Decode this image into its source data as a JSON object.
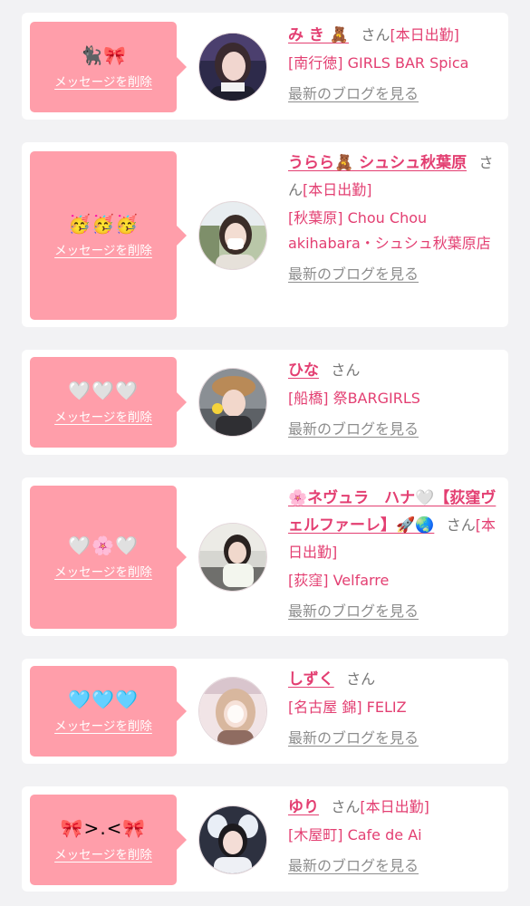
{
  "messages": [
    {
      "stamp": "🐈‍⬛🎀",
      "delete_label": "メッセージを削除",
      "name": "み き 🧸",
      "san": "さん",
      "status": "[本日出勤]",
      "shop": "[南行徳] GIRLS BAR Spica",
      "blog_label": "最新のブログを見る"
    },
    {
      "stamp": "🥳🥳🥳",
      "delete_label": "メッセージを削除",
      "name": "うらら🧸 シュシュ秋葉原",
      "san": "さん",
      "status": "[本日出勤]",
      "shop": "[秋葉原] Chou Chou akihabara・シュシュ秋葉原店",
      "blog_label": "最新のブログを見る"
    },
    {
      "stamp": "🤍🤍🤍",
      "delete_label": "メッセージを削除",
      "name": "ひな",
      "san": "さん",
      "status": "",
      "shop": "[船橋] 祭BARGIRLS",
      "blog_label": "最新のブログを見る"
    },
    {
      "stamp": "🤍🌸🤍",
      "delete_label": "メッセージを削除",
      "name": "🌸ネヴュラ　ハナ🤍【荻窪ヴェルファーレ】🚀🌏",
      "san": "さん",
      "status": "[本日出勤]",
      "shop": "[荻窪] Velfarre",
      "blog_label": "最新のブログを見る"
    },
    {
      "stamp": "🩵🩵🩵",
      "delete_label": "メッセージを削除",
      "name": "しずく",
      "san": "さん",
      "status": "",
      "shop": "[名古屋 錦] FELIZ",
      "blog_label": "最新のブログを見る"
    },
    {
      "stamp": "🎀>.<🎀",
      "delete_label": "メッセージを削除",
      "name": "ゆり",
      "san": "さん",
      "status": "[本日出勤]",
      "shop": "[木屋町] Cafe de Ai",
      "blog_label": "最新のブログを見る"
    }
  ],
  "colors": {
    "page_background": "#f2f2f4",
    "card_background": "#ffffff",
    "bubble_pink": "#ff9eaa",
    "name_pink": "#e33f72",
    "muted_gray": "#8d8d8d"
  }
}
